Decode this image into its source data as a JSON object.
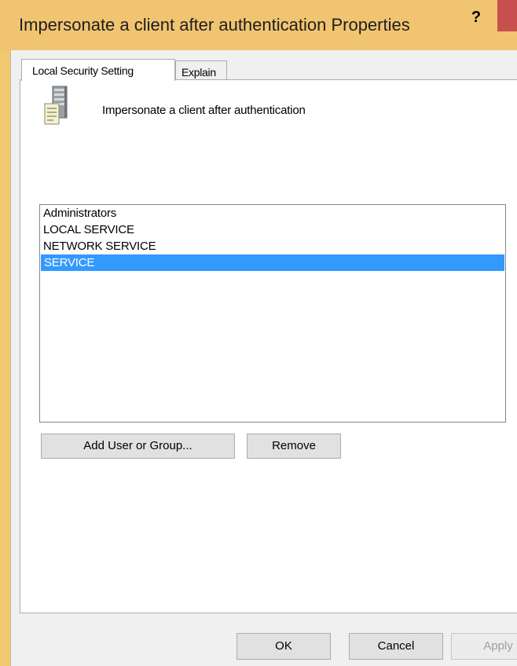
{
  "window": {
    "title": "Impersonate a client after authentication Properties",
    "help_label": "?",
    "accent_color": "#f1c471",
    "close_color": "#c7504f"
  },
  "tabs": [
    {
      "label": "Local Security Setting",
      "active": true
    },
    {
      "label": "Explain",
      "active": false
    }
  ],
  "policy": {
    "icon": "server-icon",
    "name": "Impersonate a client after authentication"
  },
  "accounts": {
    "items": [
      {
        "label": "Administrators",
        "selected": false
      },
      {
        "label": "LOCAL SERVICE",
        "selected": false
      },
      {
        "label": "NETWORK SERVICE",
        "selected": false
      },
      {
        "label": "SERVICE",
        "selected": true
      }
    ],
    "selection_color": "#3399ff"
  },
  "buttons": {
    "add": "Add User or Group...",
    "remove": "Remove",
    "ok": "OK",
    "cancel": "Cancel",
    "apply": "Apply"
  }
}
